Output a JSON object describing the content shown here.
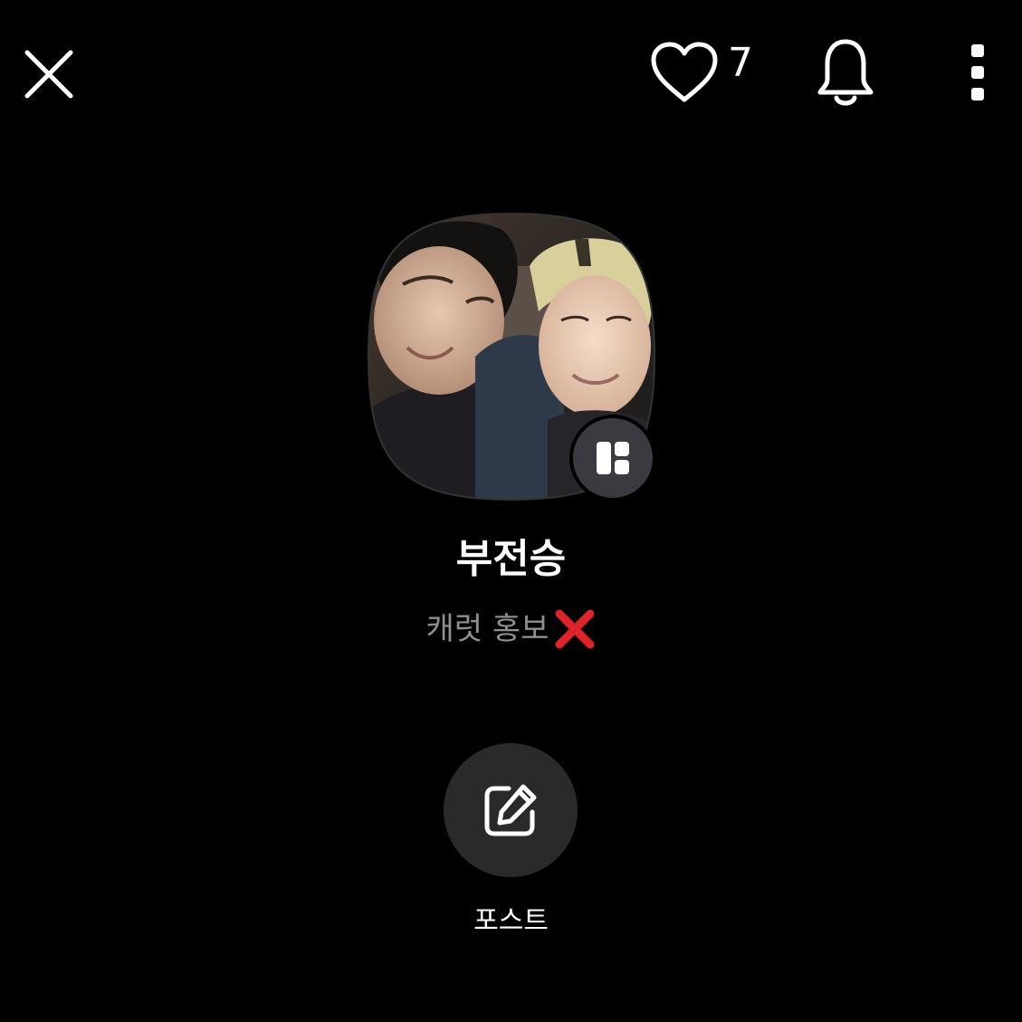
{
  "header": {
    "like_count": "7"
  },
  "icons": {
    "close": "close-icon",
    "like": "heart-icon",
    "bell": "bell-icon",
    "more": "more-vertical-icon",
    "widget": "widget-layout-icon",
    "edit": "edit-icon"
  },
  "profile": {
    "name": "부전승",
    "status": "캐럿 홍보",
    "status_emoji": "cross-mark"
  },
  "actions": {
    "post_label": "포스트"
  },
  "colors": {
    "background": "#000000",
    "status_text": "#8e8e93",
    "badge_bg": "#3a3b40",
    "post_button_bg": "#2a2a2c",
    "cross_red": "#e0232a"
  }
}
